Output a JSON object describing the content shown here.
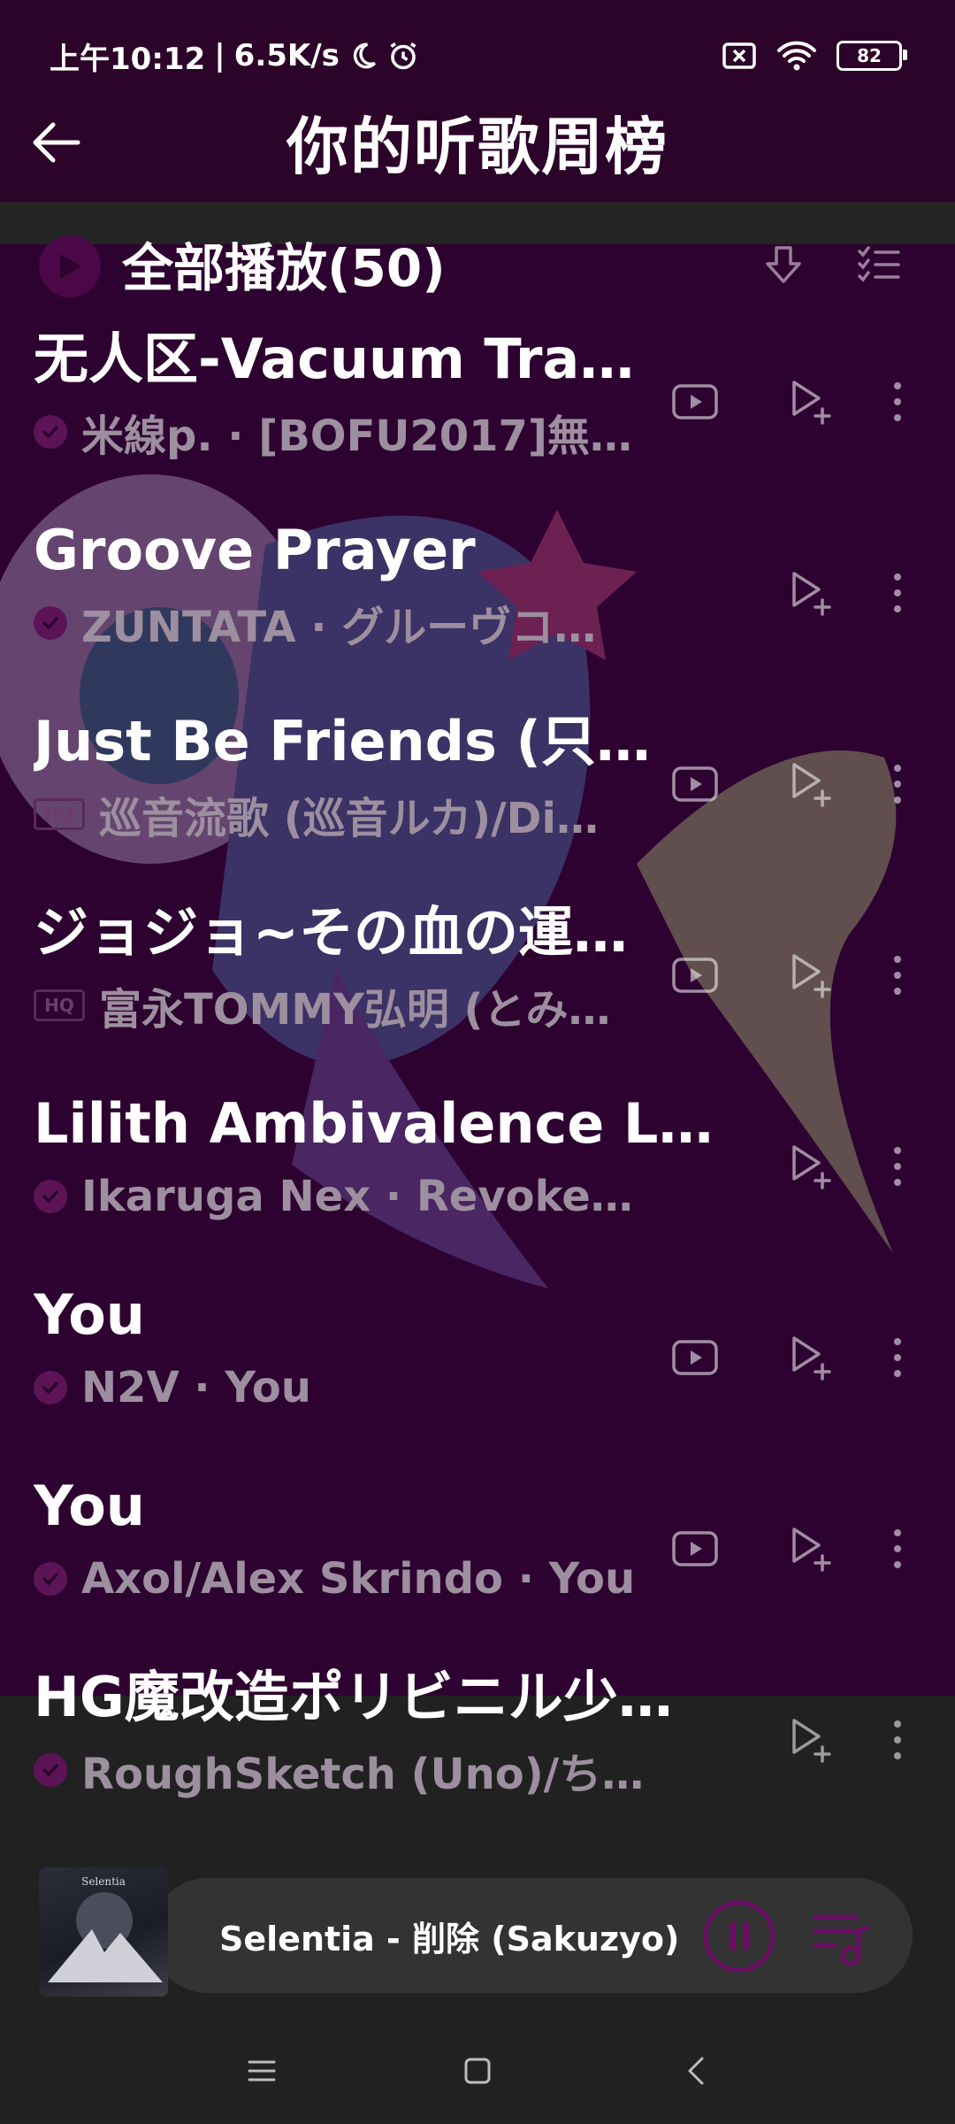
{
  "status_bar": {
    "time": "上午10:12",
    "speed": "6.5K/s",
    "battery": "82"
  },
  "header": {
    "title": "你的听歌周榜"
  },
  "list_header": {
    "play_all_label": "全部播放(50)"
  },
  "songs": [
    {
      "title": "无人区-Vacuum Tra…",
      "subtitle": "米線p. · [BOFU2017]無…",
      "badge": "check",
      "has_video": true
    },
    {
      "title": "Groove Prayer",
      "subtitle": "ZUNTATA · グルーヴコ…",
      "badge": "check",
      "has_video": false
    },
    {
      "title": "Just Be Friends (只…",
      "subtitle": "巡音流歌 (巡音ルカ)/Di…",
      "badge": "hq",
      "has_video": true
    },
    {
      "title": "ジョジョ~その血の運…",
      "subtitle": "富永TOMMY弘明 (とみ…",
      "badge": "hq",
      "has_video": true
    },
    {
      "title": "Lilith Ambivalence Lov…",
      "subtitle": "Ikaruga Nex · Revoke…",
      "badge": "check",
      "has_video": false
    },
    {
      "title": "You",
      "subtitle": "N2V · You",
      "badge": "check",
      "has_video": true
    },
    {
      "title": "You",
      "subtitle": "Axol/Alex Skrindo · You",
      "badge": "check",
      "has_video": true
    },
    {
      "title": "HG魔改造ポリビニル少…",
      "subtitle": "RoughSketch (Uno)/ちよこ…",
      "badge": "check",
      "has_video": false
    }
  ],
  "hq_label": "HQ",
  "now_playing": {
    "title": "Selentia - 削除 (Sakuzyo)",
    "cover_text": "Selentia"
  },
  "colors": {
    "header_bg": "#2c0329",
    "panel_bg": "#2d0230",
    "accent": "#6a0c62",
    "muted_text": "#9d8f9f"
  },
  "icons": {
    "back": "arrow-left-icon",
    "play_all": "play-circle-icon",
    "download": "download-icon",
    "multiselect": "checklist-icon",
    "video": "video-play-icon",
    "add_to_playlist": "add-playlist-icon",
    "more": "more-vertical-icon",
    "pause": "pause-circle-icon",
    "queue": "playlist-icon"
  }
}
